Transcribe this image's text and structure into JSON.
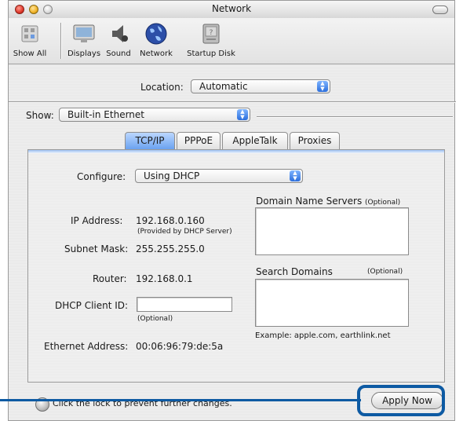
{
  "window": {
    "title": "Network"
  },
  "toolbar": {
    "items": [
      {
        "label": "Show All",
        "icon": "apple-system-prefs-icon"
      },
      {
        "label": "Displays",
        "icon": "display-icon"
      },
      {
        "label": "Sound",
        "icon": "speaker-icon"
      },
      {
        "label": "Network",
        "icon": "globe-icon"
      },
      {
        "label": "Startup Disk",
        "icon": "disk-icon"
      }
    ]
  },
  "location": {
    "label": "Location:",
    "value": "Automatic"
  },
  "show": {
    "label": "Show:",
    "value": "Built-in Ethernet"
  },
  "tabs": [
    "TCP/IP",
    "PPPoE",
    "AppleTalk",
    "Proxies"
  ],
  "tcpip": {
    "configure_label": "Configure:",
    "configure_value": "Using DHCP",
    "ip_label": "IP Address:",
    "ip_value": "192.168.0.160",
    "ip_note": "(Provided by DHCP Server)",
    "subnet_label": "Subnet Mask:",
    "subnet_value": "255.255.255.0",
    "router_label": "Router:",
    "router_value": "192.168.0.1",
    "dhcp_label": "DHCP Client ID:",
    "dhcp_value": "",
    "dhcp_note": "(Optional)",
    "ethernet_label": "Ethernet Address:",
    "ethernet_value": "00:06:96:79:de:5a",
    "dns_label": "Domain Name Servers",
    "dns_optional": "(Optional)",
    "search_label": "Search Domains",
    "search_optional": "(Optional)",
    "example": "Example: apple.com, earthlink.net"
  },
  "footer": {
    "lock_text": "Click the lock to prevent further changes.",
    "apply_label": "Apply Now"
  },
  "colors": {
    "callout": "#0d5aa3",
    "tab_active": "#6aa2f0"
  }
}
